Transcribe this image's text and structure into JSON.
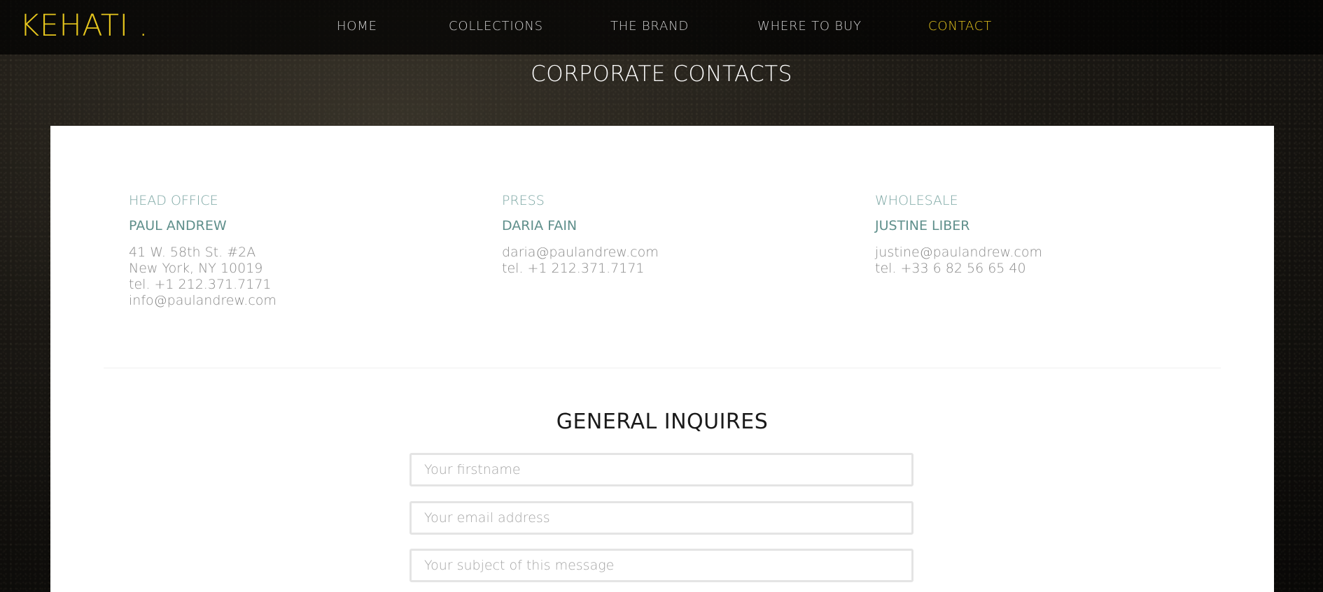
{
  "header": {
    "logo": "KEHATI .",
    "nav": [
      {
        "label": "HOME"
      },
      {
        "label": "COLLECTIONS"
      },
      {
        "label": "THE BRAND"
      },
      {
        "label": "WHERE TO BUY"
      },
      {
        "label": "CONTACT",
        "active": true
      }
    ],
    "accent_color": "#e6c61d"
  },
  "page": {
    "title": "CORPORATE CONTACTS"
  },
  "contacts": [
    {
      "department": "HEAD OFFICE",
      "name": "PAUL ANDREW",
      "lines": [
        "41 W. 58th St. #2A",
        "New York, NY 10019",
        "tel. +1 212.371.7171",
        "info@paulandrew.com"
      ]
    },
    {
      "department": "PRESS",
      "name": "DARIA FAIN",
      "lines": [
        "daria@paulandrew.com",
        "tel. +1 212.371.7171"
      ]
    },
    {
      "department": "WHOLESALE",
      "name": "JUSTINE LIBER",
      "lines": [
        "justine@paulandrew.com",
        "tel. +33 6 82 56 65 40"
      ]
    }
  ],
  "form": {
    "title": "GENERAL INQUIRES",
    "firstname_placeholder": "Your firstname",
    "email_placeholder": "Your email address",
    "subject_placeholder": "Your subject of this message"
  },
  "colors": {
    "contact_heading": "#7da7a4",
    "contact_name": "#5f8f8b",
    "panel": "#ffffff"
  }
}
